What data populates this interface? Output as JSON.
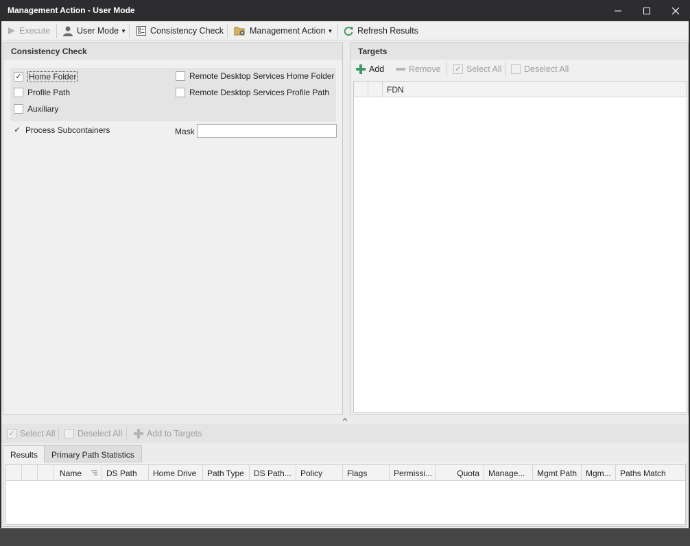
{
  "window": {
    "title": "Management Action - User Mode",
    "minimize": "—",
    "maximize": "☐",
    "close": "✕"
  },
  "toolbar": {
    "execute": "Execute",
    "user_mode": "User Mode",
    "consistency_check": "Consistency Check",
    "management_action": "Management Action",
    "refresh_results": "Refresh Results"
  },
  "consistency_panel": {
    "title": "Consistency Check",
    "options": [
      {
        "label": "Home Folder",
        "checked": true
      },
      {
        "label": "Profile Path",
        "checked": false
      },
      {
        "label": "Auxiliary",
        "checked": false
      },
      {
        "label": "Remote Desktop Services Home Folder",
        "checked": false
      },
      {
        "label": "Remote Desktop Services Profile Path",
        "checked": false
      }
    ],
    "process_subcontainers": {
      "label": "Process Subcontainers",
      "checked": true
    },
    "mask_label": "Mask",
    "mask_value": ""
  },
  "targets_panel": {
    "title": "Targets",
    "add": "Add",
    "remove": "Remove",
    "select_all": "Select All",
    "deselect_all": "Deselect All",
    "column": "FDN"
  },
  "results_toolbar": {
    "select_all": "Select All",
    "deselect_all": "Deselect All",
    "add_to_targets": "Add to Targets"
  },
  "tabs": [
    "Results",
    "Primary Path Statistics"
  ],
  "results_columns": [
    "Name",
    "DS Path",
    "Home Drive",
    "Path Type",
    "DS Path...",
    "Policy",
    "Flags",
    "Permissi...",
    "Quota",
    "Manage...",
    "Mgmt Path",
    "Mgm...",
    "Paths Match"
  ],
  "colors": {
    "titlebar": "#2d2d30",
    "accent_green": "#3c9a5f",
    "panel_bg": "#f0f0f0"
  }
}
